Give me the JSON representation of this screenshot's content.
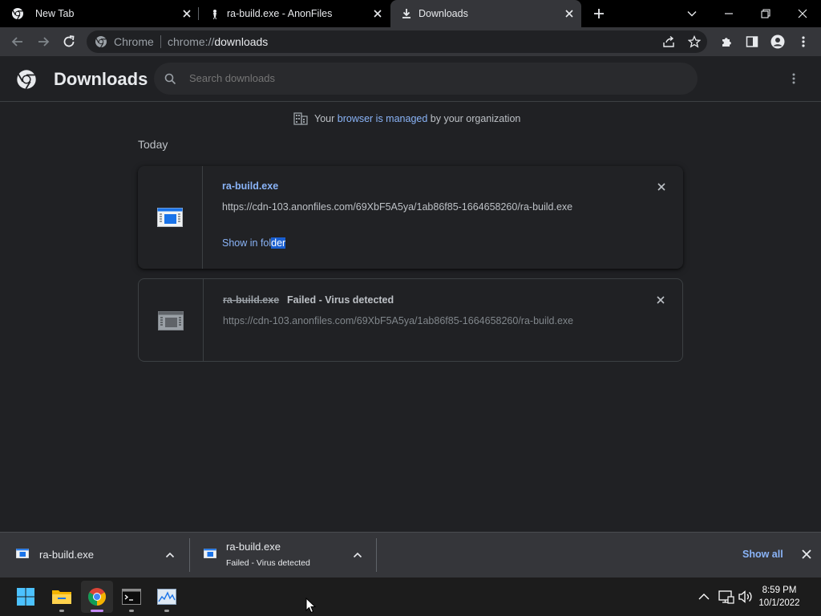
{
  "tabs": [
    {
      "title": "New Tab",
      "icon": "chrome-icon"
    },
    {
      "title": "ra-build.exe - AnonFiles",
      "icon": "anonfiles-icon"
    },
    {
      "title": "Downloads",
      "icon": "download-icon",
      "active": true
    }
  ],
  "omnibox": {
    "chip": "Chrome",
    "url_scheme": "chrome://",
    "url_host": "downloads"
  },
  "page": {
    "title": "Downloads",
    "search_placeholder": "Search downloads",
    "managed_prefix": "Your",
    "managed_link": "browser is managed",
    "managed_suffix": "by your organization",
    "section": "Today"
  },
  "downloads": [
    {
      "filename": "ra-build.exe",
      "url": "https://cdn-103.anonfiles.com/69XbF5A5ya/1ab86f85-1664658260/ra-build.exe",
      "action_part1": "Show in fol",
      "action_part2": "der"
    },
    {
      "filename": "ra-build.exe",
      "status": "Failed - Virus detected",
      "url": "https://cdn-103.anonfiles.com/69XbF5A5ya/1ab86f85-1664658260/ra-build.exe"
    }
  ],
  "shelf": {
    "items": [
      {
        "name": "ra-build.exe"
      },
      {
        "name": "ra-build.exe",
        "status": "Failed - Virus detected"
      }
    ],
    "show_all": "Show all"
  },
  "taskbar": {
    "apps": [
      "start-icon",
      "file-explorer-icon",
      "chrome-icon",
      "terminal-icon",
      "resource-monitor-icon"
    ],
    "time": "8:59 PM",
    "date": "10/1/2022"
  },
  "colors": {
    "accent": "#8ab4f8",
    "background": "#202124",
    "toolbar": "#35363a",
    "selection": "#1a5fd0"
  }
}
